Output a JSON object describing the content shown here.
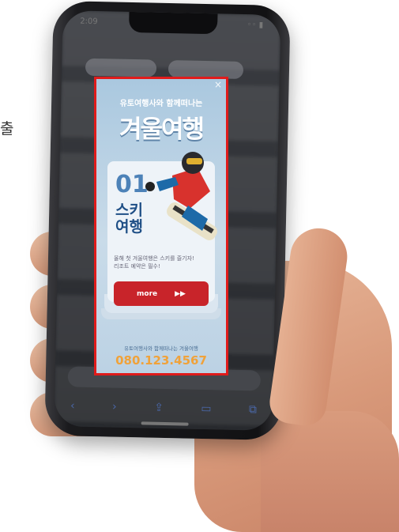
{
  "side_text": "출",
  "status": {
    "time": "2:09",
    "icons": "◦◦ ▮"
  },
  "ad": {
    "close_icon": "×",
    "subtitle": "유토여행사와 함께떠나는",
    "title": "겨울여행",
    "number": "01",
    "category": "스키 여행",
    "description": "올해 첫 겨울여행은 스키를 즐기자! 리조트 예약은 필수!",
    "more_label": "more",
    "more_arrows": "▶▶",
    "footer_text": "유토여행사와 함께떠나는 겨울여행",
    "phone": "080.123.4567"
  },
  "colors": {
    "ad_border": "#e01b1b",
    "button": "#c8242a",
    "phone_number": "#f0a23a",
    "title_blue": "#1f4f86"
  },
  "bottom_icons": [
    "back-icon",
    "forward-icon",
    "share-icon",
    "book-icon",
    "tabs-icon"
  ]
}
